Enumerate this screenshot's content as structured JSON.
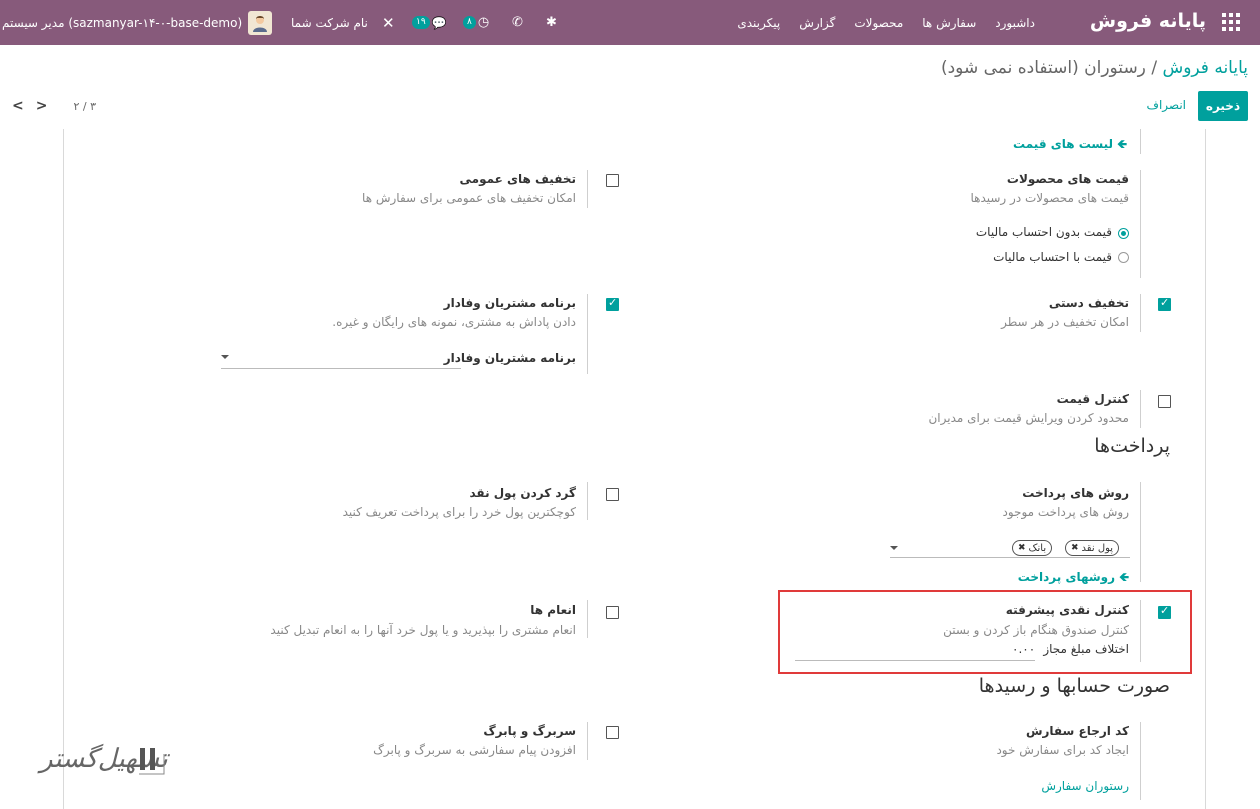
{
  "navbar": {
    "brand": "پایانه فروش",
    "menu": [
      "داشبورد",
      "سفارش ها",
      "محصولات",
      "گزارش",
      "پیکربندی"
    ],
    "activity_count": "۸",
    "messages_count": "۱۹",
    "company": "نام شرکت شما",
    "user": "مدیر سیستم (sazmanyar-۱۴-۰-base-demo)",
    "accent_color": "#875a7b"
  },
  "breadcrumb": {
    "root": "پایانه فروش",
    "separator": "/",
    "current": "رستوران (استفاده نمی شود)"
  },
  "actions": {
    "save": "ذخیره",
    "discard": "انصراف"
  },
  "pager": {
    "value": "۲ / ۳"
  },
  "settings": {
    "pricelists_link": "لیست های قیمت",
    "product_prices": {
      "title": "قیمت های محصولات",
      "desc": "قیمت های محصولات در رسیدها",
      "options": [
        "قیمت بدون احتساب مالیات",
        "قیمت با احتساب مالیات"
      ],
      "selected": 0
    },
    "global_discounts": {
      "title": "تخفیف های عمومی",
      "desc": "امکان تخفیف های عمومی برای سفارش ها",
      "checked": false
    },
    "manual_discount": {
      "title": "تخفیف دستی",
      "desc": "امکان تخفیف در هر سطر",
      "checked": true
    },
    "loyalty": {
      "title": "برنامه مشتریان وفادار",
      "desc": "دادن پاداش به مشتری، نمونه های رایگان و غیره.",
      "field_label": "برنامه مشتریان وفادار",
      "checked": true
    },
    "price_control": {
      "title": "کنترل قیمت",
      "desc": "محدود کردن ویرایش قیمت برای مدیران",
      "checked": false
    },
    "payments_section": "پرداخت‌ها",
    "payment_methods": {
      "title": "روش های پرداخت",
      "desc": "روش های پرداخت موجود",
      "tags": [
        "پول نقد",
        "بانک"
      ],
      "link": "روشهای پرداخت"
    },
    "cash_rounding": {
      "title": "گرد کردن پول نقد",
      "desc": "کوچکترین پول خرد را برای پرداخت تعریف کنید",
      "checked": false
    },
    "advanced_cash_control": {
      "title": "کنترل نقدی پیشرفته",
      "desc": "کنترل صندوق هنگام باز کردن و بستن",
      "field_label": "اختلاف مبلغ مجاز",
      "field_value": "۰.۰۰",
      "checked": true
    },
    "tips": {
      "title": "انعام ها",
      "desc": "انعام مشتری را بپذیرید و یا پول خرد آنها را به انعام تبدیل کنید",
      "checked": false
    },
    "bills_section": "صورت حسابها و رسیدها",
    "order_reference": {
      "title": "کد ارجاع سفارش",
      "desc": "ایجاد کد برای سفارش خود",
      "value": "رستوران سفارش"
    },
    "header_footer": {
      "title": "سربرگ و پابرگ",
      "desc": "افزودن پیام سفارشی به سربرگ و پابرگ",
      "checked": false
    }
  },
  "watermark": {
    "text": "تسهیل‌گستر"
  }
}
